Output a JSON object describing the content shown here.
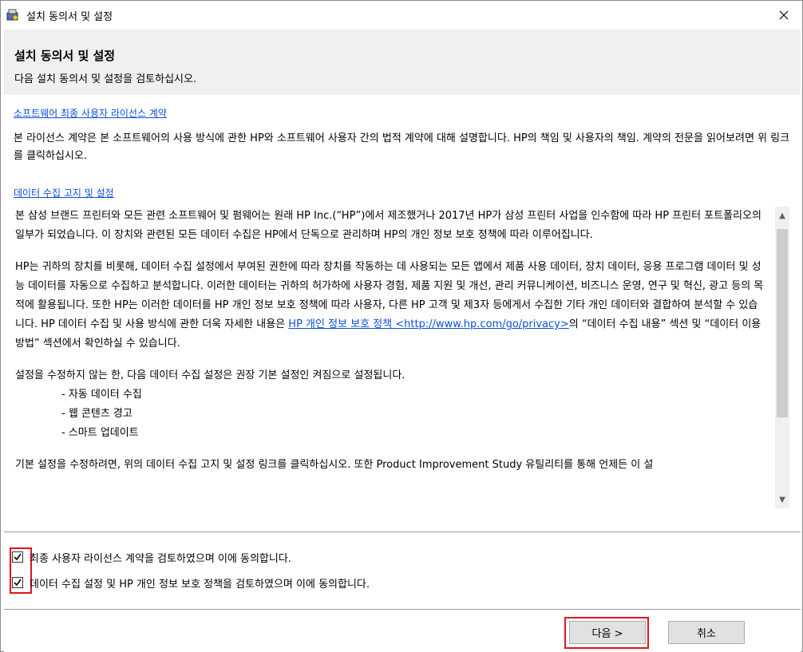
{
  "window": {
    "title": "설치 동의서 및 설정"
  },
  "header": {
    "title": "설치 동의서 및 설정",
    "subtitle": "다음 설치 동의서 및 설정을 검토하십시오."
  },
  "eula": {
    "link_label": "소프트웨어 최종 사용자 라이선스 계약",
    "description": "본 라이선스 계약은 본 소프트웨어의 사용 방식에 관한 HP와 소프트웨어 사용자 간의 법적 계약에 대해 설명합니다. HP의 책임 및 사용자의 책임. 계약의 전문을 읽어보려면 위 링크를 클릭하십시오."
  },
  "data_collection": {
    "link_label": "데이터 수집 고지 및 설정",
    "para1": "본 삼성 브랜드 프린터와 모든 관련 소프트웨어 및 펌웨어는 원래 HP Inc.(“HP”)에서 제조했거나 2017년 HP가 삼성 프린터 사업을 인수함에 따라 HP 프린터 포트폴리오의 일부가 되었습니다. 이 장치와 관련된 모든 데이터 수집은 HP에서 단독으로 관리하며 HP의 개인 정보 보호 정책에 따라 이루어집니다.",
    "para2_before_link": "HP는 귀하의 장치를 비롯해, 데이터 수집 설정에서 부여된 권한에 따라 장치를 작동하는 데 사용되는 모든 앱에서 제품 사용 데이터, 장치 데이터, 응용 프로그램 데이터 및 성능 데이터를 자동으로 수집하고 분석합니다. 이러한 데이터는 귀하의 허가하에 사용자 경험, 제품 지원 및 개선, 관리 커뮤니케이션, 비즈니스 운영, 연구 및 혁신, 광고 등의 목적에 활용됩니다. 또한 HP는 이러한 데이터를 HP 개인 정보 보호 정책에 따라 사용자, 다른 HP 고객 및 제3자 등에게서 수집한 기타 개인 데이터와 결합하여 분석할 수 있습니다. HP 데이터 수집 및 사용 방식에 관한 더욱 자세한 내용은 ",
    "privacy_link": "HP 개인 정보 보호 정책 <http://www.hp.com/go/privacy>",
    "para2_after_link": "의 “데이터 수집 내용” 섹션 및 “데이터 이용 방법” 섹션에서 확인하실 수 있습니다.",
    "para3": "설정을 수정하지 않는 한, 다음 데이터 수집 설정은 권장 기본 설정인 켜짐으로 설정됩니다.",
    "bullets": [
      "- 자동 데이터 수집",
      "- 웹 콘텐츠 경고",
      "- 스마트 업데이트"
    ],
    "para4": "기본 설정을 수정하려면, 위의 데이터 수집 고지 및 설정 링크를 클릭하십시오. 또한 Product Improvement Study 유틸리티를 통해 언제든 이 설"
  },
  "checkboxes": [
    {
      "label": "최종 사용자 라이선스 계약을 검토하였으며 이에 동의합니다.",
      "checked": true
    },
    {
      "label": "데이터 수집 설정 및 HP 개인 정보 보호 정책을 검토하였으며 이에 동의합니다.",
      "checked": true
    }
  ],
  "buttons": {
    "next_label": "다음 >",
    "cancel_label": "취소"
  },
  "colors": {
    "link": "#0b4fd9",
    "highlight": "#e0141e",
    "header_bg": "#f0f0f0"
  }
}
